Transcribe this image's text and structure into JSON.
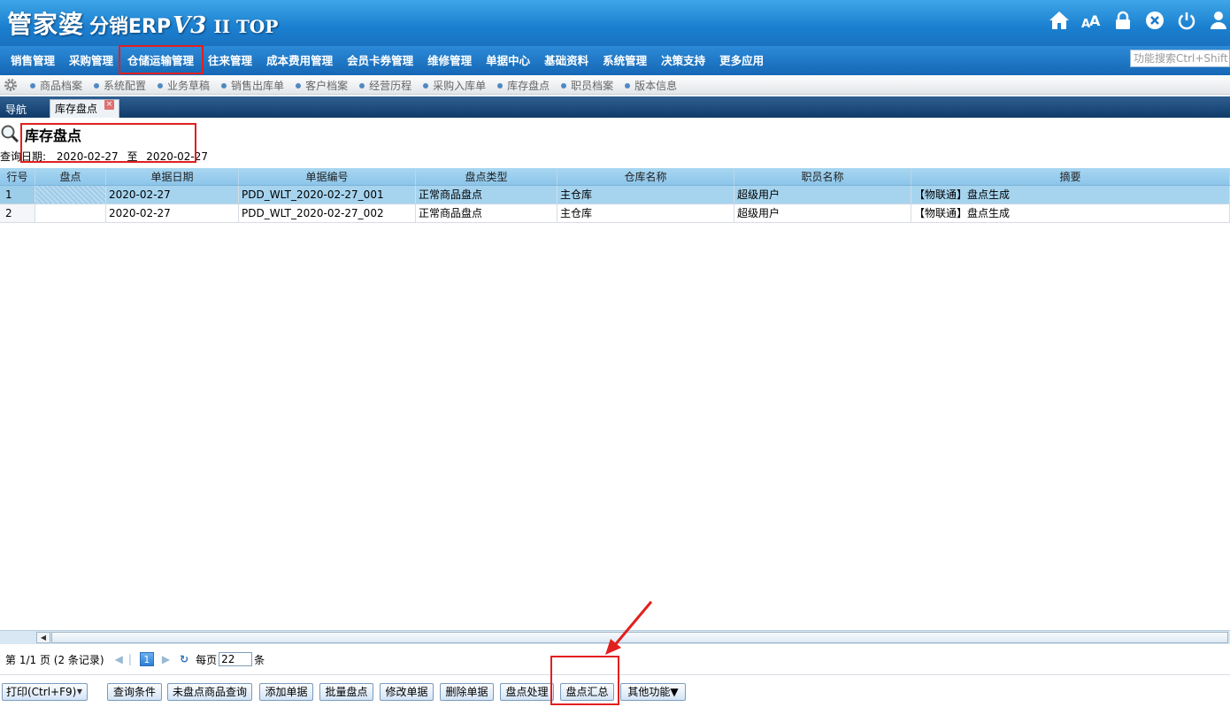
{
  "header": {
    "logo_main": "管家婆",
    "logo_sub": "分销ERP",
    "logo_ver": "V3",
    "logo_edition": "II TOP",
    "icons": [
      "home-icon",
      "font-size-icon",
      "lock-icon",
      "close-icon",
      "power-icon",
      "user-icon"
    ]
  },
  "menu": {
    "items": [
      "销售管理",
      "采购管理",
      "仓储运输管理",
      "往来管理",
      "成本费用管理",
      "会员卡券管理",
      "维修管理",
      "单据中心",
      "基础资料",
      "系统管理",
      "决策支持",
      "更多应用"
    ],
    "highlighted": "仓储运输管理"
  },
  "search": {
    "placeholder": "功能搜索Ctrl+Shift+F"
  },
  "quicklinks": [
    "商品档案",
    "系统配置",
    "业务草稿",
    "销售出库单",
    "客户档案",
    "经营历程",
    "采购入库单",
    "库存盘点",
    "职员档案",
    "版本信息"
  ],
  "tabs": {
    "nav": "导航",
    "active": "库存盘点",
    "close_glyph": "×"
  },
  "page": {
    "title": "库存盘点",
    "date_label": "查询日期:",
    "date_from": "2020-02-27",
    "date_to_label": "至",
    "date_to": "2020-02-27"
  },
  "grid": {
    "columns": [
      "行号",
      "盘点",
      "单据日期",
      "单据编号",
      "盘点类型",
      "仓库名称",
      "职员名称",
      "摘要"
    ],
    "rows": [
      {
        "no": "1",
        "check": "",
        "date": "2020-02-27",
        "code": "PDD_WLT_2020-02-27_001",
        "type": "正常商品盘点",
        "warehouse": "主仓库",
        "staff": "超级用户",
        "memo": "【物联通】盘点生成"
      },
      {
        "no": "2",
        "check": "",
        "date": "2020-02-27",
        "code": "PDD_WLT_2020-02-27_002",
        "type": "正常商品盘点",
        "warehouse": "主仓库",
        "staff": "超级用户",
        "memo": "【物联通】盘点生成"
      }
    ]
  },
  "pager": {
    "text": "第  1/1 页  (2 条记录)",
    "current": "1",
    "per_page_label": "每页",
    "per_page": "22",
    "unit": "条"
  },
  "buttons": {
    "print": "打印(Ctrl+F9)",
    "query": "查询条件",
    "unchecked": "未盘点商品查询",
    "add": "添加单据",
    "batch": "批量盘点",
    "edit": "修改单据",
    "delete": "删除单据",
    "process": "盘点处理",
    "summary": "盘点汇总",
    "other": "其他功能▼"
  },
  "colors": {
    "accent": "#1a7fcf",
    "highlight": "#e21f1f",
    "selected_row": "#a6d4ef"
  }
}
